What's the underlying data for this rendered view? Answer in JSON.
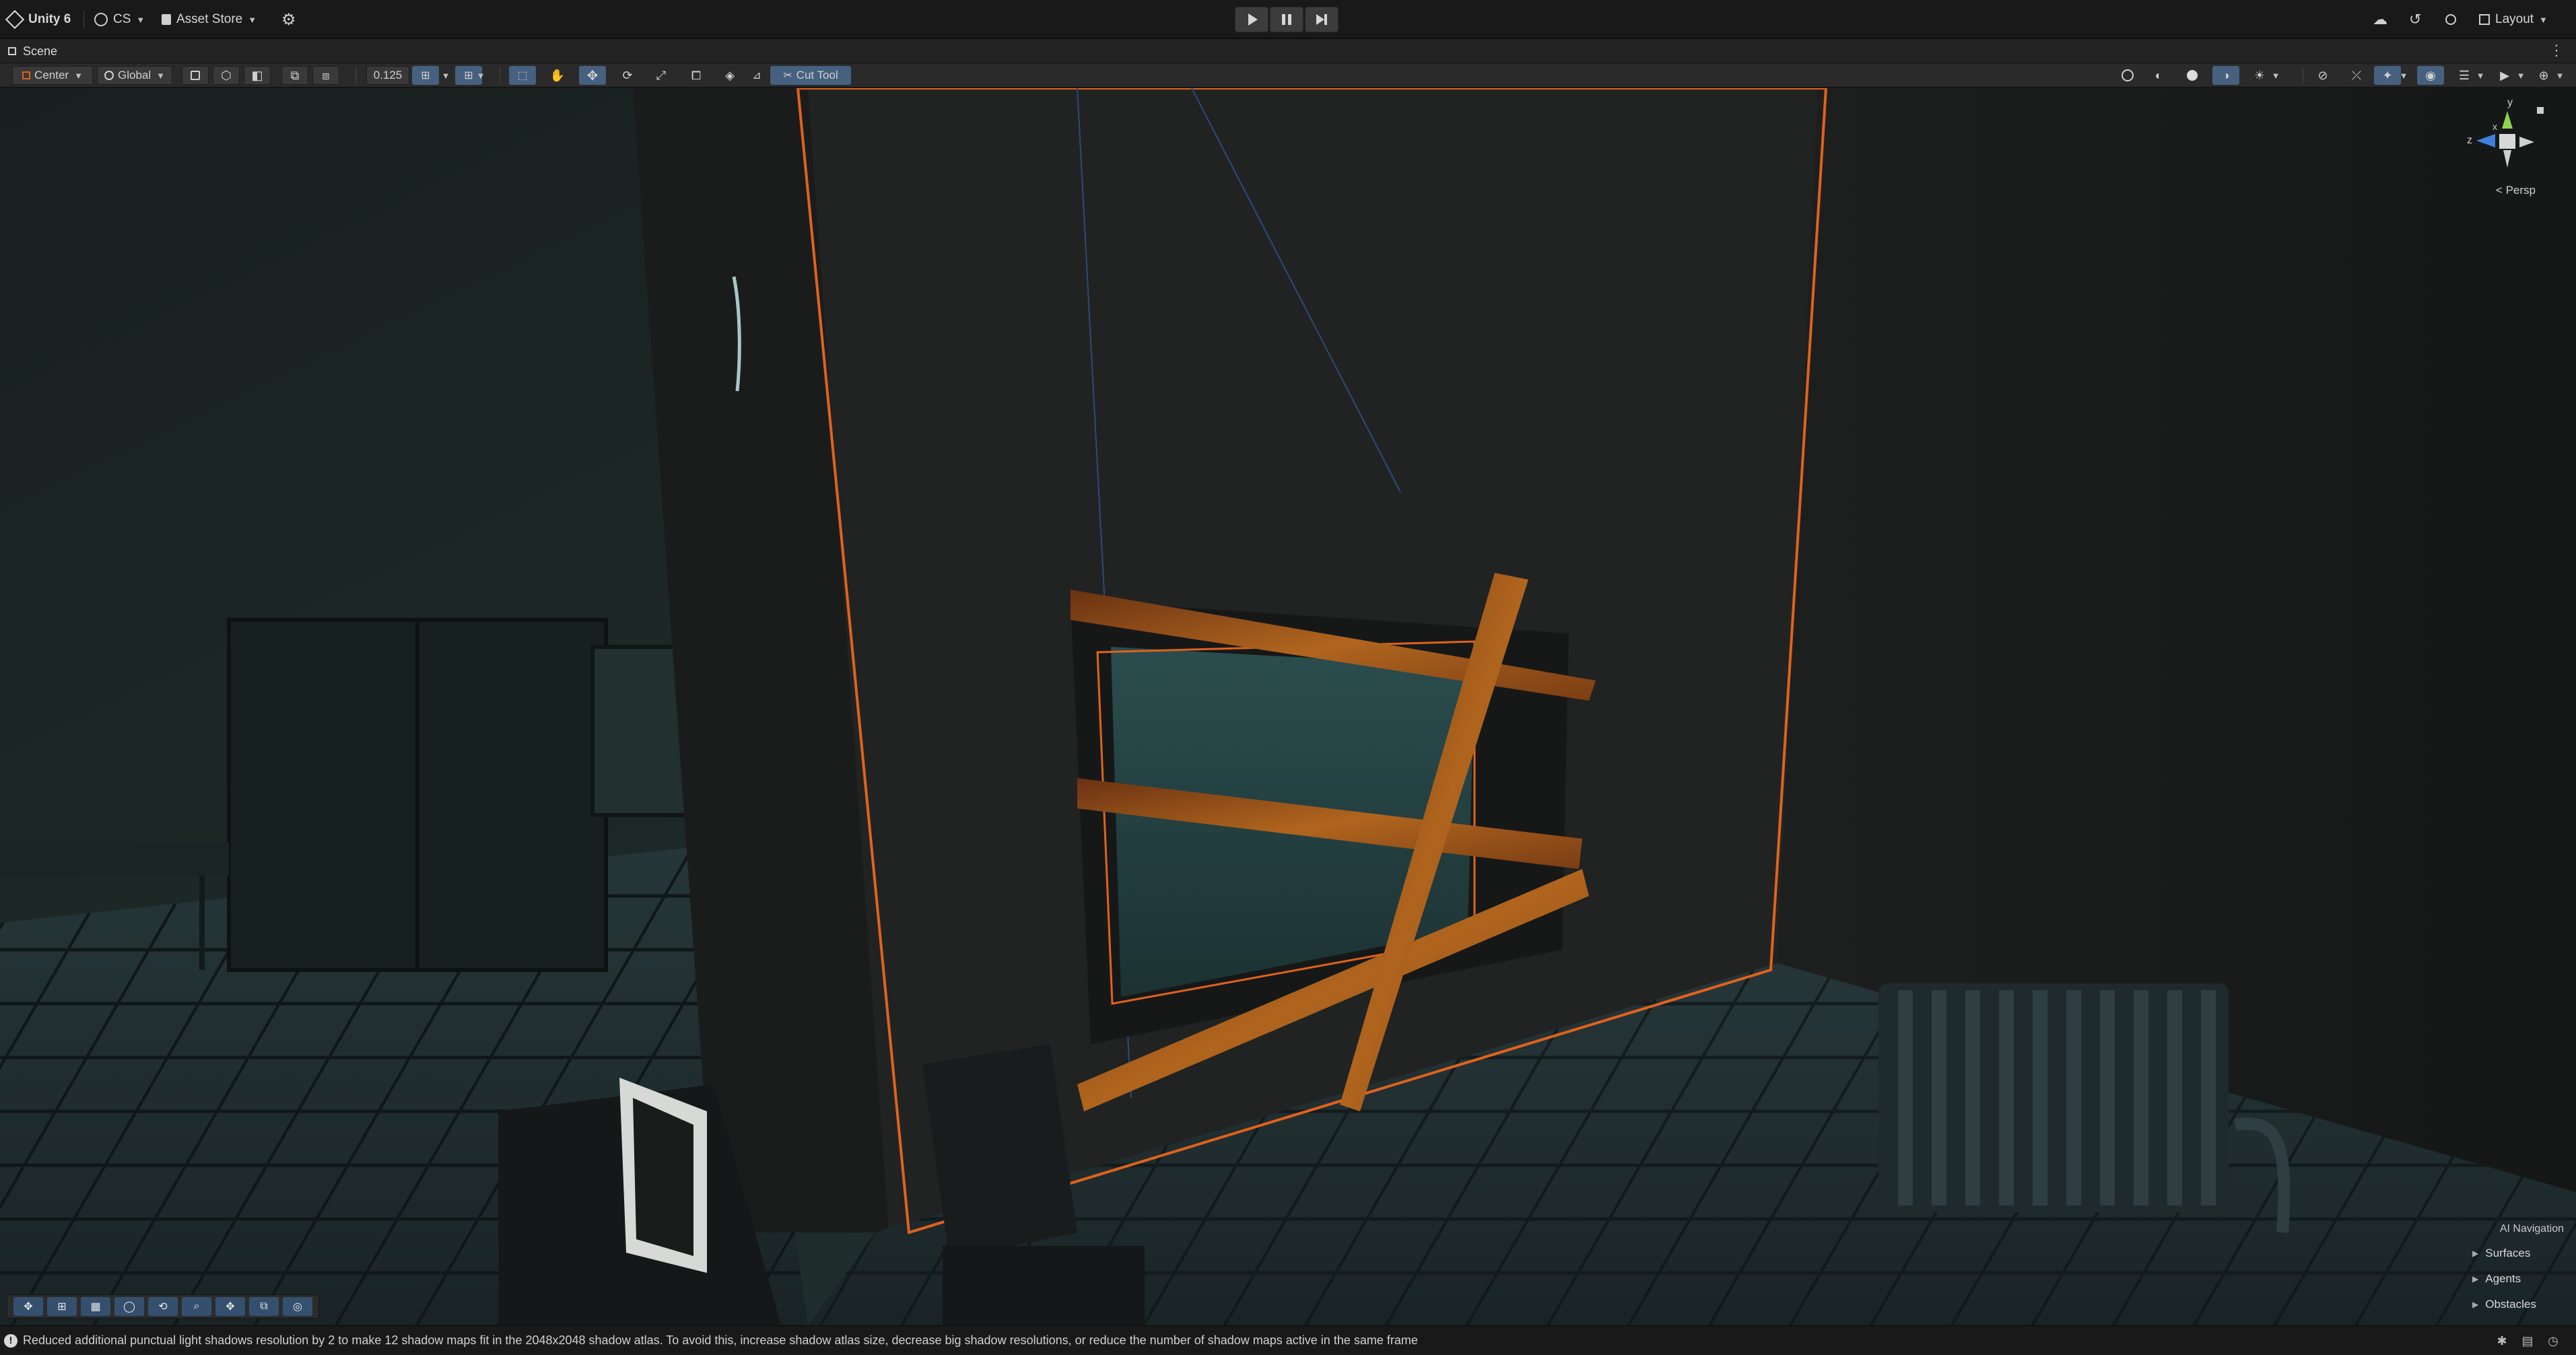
{
  "topbar": {
    "app_name": "Unity 6",
    "account": "CS",
    "asset_store": "Asset Store",
    "layout": "Layout"
  },
  "tab": {
    "scene": "Scene"
  },
  "scene_toolbar": {
    "pivot_mode": "Center",
    "pivot_rotation": "Global",
    "grid_snap_value": "0.125",
    "cut_tool": "Cut Tool"
  },
  "viewport": {
    "projection": "Persp",
    "gizmo_axes": {
      "y": "y",
      "x": "x",
      "z": "z"
    }
  },
  "ai_navigation": {
    "title": "AI Navigation",
    "items": [
      "Surfaces",
      "Agents",
      "Obstacles"
    ]
  },
  "status": {
    "message": "Reduced additional punctual light shadows resolution by 2 to make 12 shadow maps fit in the 2048x2048 shadow atlas. To avoid this, increase shadow atlas size, decrease big shadow resolutions, or reduce the number of shadow maps active in the same frame"
  },
  "colors": {
    "selection_outline": "#e0621c",
    "active_tool": "#46607f",
    "wood": "#b0651e"
  }
}
